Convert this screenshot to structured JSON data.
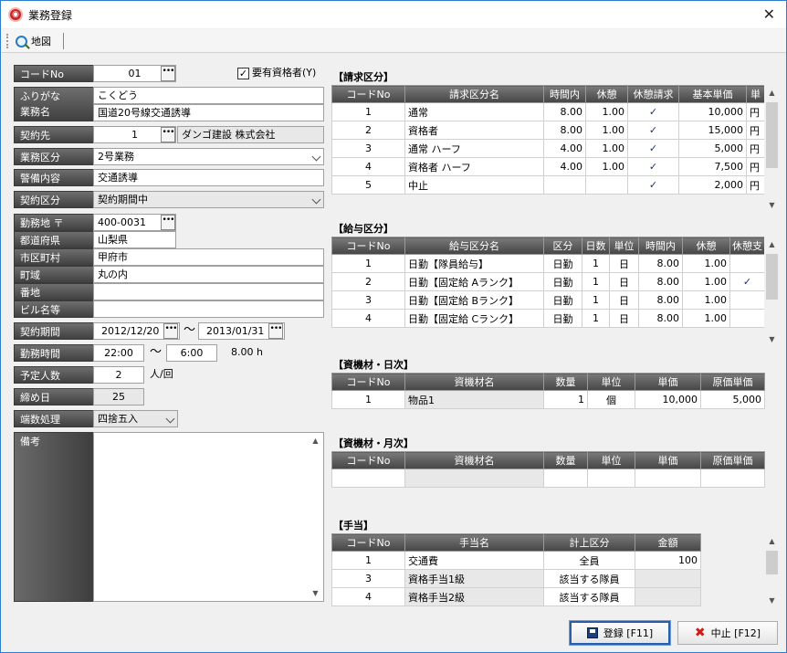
{
  "window": {
    "title": "業務登録",
    "app_icon": "app-logo-icon"
  },
  "toolbar": {
    "map_label": "地図"
  },
  "form": {
    "code_label": "コードNo",
    "code_value": "01",
    "qualified_label": "要有資格者(Y)",
    "qualified_checked": true,
    "furigana_label": "ふりがな",
    "furigana_value": "こくどう",
    "name_label": "業務名",
    "name_value": "国道20号線交通誘導",
    "contractor_label": "契約先",
    "contractor_code": "1",
    "contractor_name": "ダンゴ建設 株式会社",
    "category_label": "業務区分",
    "category_value": "2号業務",
    "guard_label": "警備内容",
    "guard_value": "交通誘導",
    "contract_type_label": "契約区分",
    "contract_type_value": "契約期間中",
    "work_place_label": "勤務地 〒",
    "postal_value": "400-0031",
    "pref_label": "都道府県",
    "pref_value": "山梨県",
    "city_label": "市区町村",
    "city_value": "甲府市",
    "town_label": "町域",
    "town_value": "丸の内",
    "banchi_label": "番地",
    "banchi_value": "",
    "building_label": "ビル名等",
    "building_value": "",
    "period_label": "契約期間",
    "period_from": "2012/12/20",
    "period_tilde": "〜",
    "period_to": "2013/01/31",
    "hours_label": "勤務時間",
    "hours_from": "22:00",
    "hours_tilde": "〜",
    "hours_to": "6:00",
    "hours_total": "8.00 h",
    "planned_label": "予定人数",
    "planned_value": "2",
    "planned_unit": "人/回",
    "closing_label": "締め日",
    "closing_value": "25",
    "rounding_label": "端数処理",
    "rounding_value": "四捨五入",
    "notes_label": "備考",
    "notes_value": ""
  },
  "billing": {
    "title": "【請求区分】",
    "headers": [
      "コードNo",
      "請求区分名",
      "時間内",
      "休憩",
      "休憩請求",
      "基本単価",
      "単"
    ],
    "rows": [
      {
        "code": "1",
        "name": "通常",
        "time": "8.00",
        "rest": "1.00",
        "rest_bill": "✓",
        "price": "10,000",
        "unit": "円"
      },
      {
        "code": "2",
        "name": "資格者",
        "time": "8.00",
        "rest": "1.00",
        "rest_bill": "✓",
        "price": "15,000",
        "unit": "円"
      },
      {
        "code": "3",
        "name": "通常 ハーフ",
        "time": "4.00",
        "rest": "1.00",
        "rest_bill": "✓",
        "price": "5,000",
        "unit": "円"
      },
      {
        "code": "4",
        "name": "資格者 ハーフ",
        "time": "4.00",
        "rest": "1.00",
        "rest_bill": "✓",
        "price": "7,500",
        "unit": "円"
      },
      {
        "code": "5",
        "name": "中止",
        "time": "",
        "rest": "",
        "rest_bill": "✓",
        "price": "2,000",
        "unit": "円"
      }
    ]
  },
  "salary": {
    "title": "【給与区分】",
    "headers": [
      "コードNo",
      "給与区分名",
      "区分",
      "日数",
      "単位",
      "時間内",
      "休憩",
      "休憩支"
    ],
    "rows": [
      {
        "code": "1",
        "name": "日勤【隊員給与】",
        "kubun": "日勤",
        "days": "1",
        "unit": "日",
        "time": "8.00",
        "rest": "1.00",
        "rest_pay": ""
      },
      {
        "code": "2",
        "name": "日勤【固定給 Aランク】",
        "kubun": "日勤",
        "days": "1",
        "unit": "日",
        "time": "8.00",
        "rest": "1.00",
        "rest_pay": "✓"
      },
      {
        "code": "3",
        "name": "日勤【固定給 Bランク】",
        "kubun": "日勤",
        "days": "1",
        "unit": "日",
        "time": "8.00",
        "rest": "1.00",
        "rest_pay": ""
      },
      {
        "code": "4",
        "name": "日勤【固定給 Cランク】",
        "kubun": "日勤",
        "days": "1",
        "unit": "日",
        "time": "8.00",
        "rest": "1.00",
        "rest_pay": ""
      }
    ]
  },
  "mat_daily": {
    "title": "【資機材・日次】",
    "headers": [
      "コードNo",
      "資機材名",
      "数量",
      "単位",
      "単価",
      "原価単価"
    ],
    "rows": [
      {
        "code": "1",
        "name": "物品1",
        "qty": "1",
        "unit": "個",
        "price": "10,000",
        "cost": "5,000"
      }
    ]
  },
  "mat_monthly": {
    "title": "【資機材・月次】",
    "headers": [
      "コードNo",
      "資機材名",
      "数量",
      "単位",
      "単価",
      "原価単価"
    ]
  },
  "allowance": {
    "title": "【手当】",
    "headers": [
      "コードNo",
      "手当名",
      "計上区分",
      "金額"
    ],
    "rows": [
      {
        "code": "1",
        "name": "交通費",
        "kubun": "全員",
        "amount": "100"
      },
      {
        "code": "3",
        "name": "資格手当1級",
        "kubun": "該当する隊員",
        "amount": ""
      },
      {
        "code": "4",
        "name": "資格手当2級",
        "kubun": "該当する隊員",
        "amount": ""
      }
    ]
  },
  "buttons": {
    "save": "登録 [F11]",
    "cancel": "中止 [F12]"
  }
}
